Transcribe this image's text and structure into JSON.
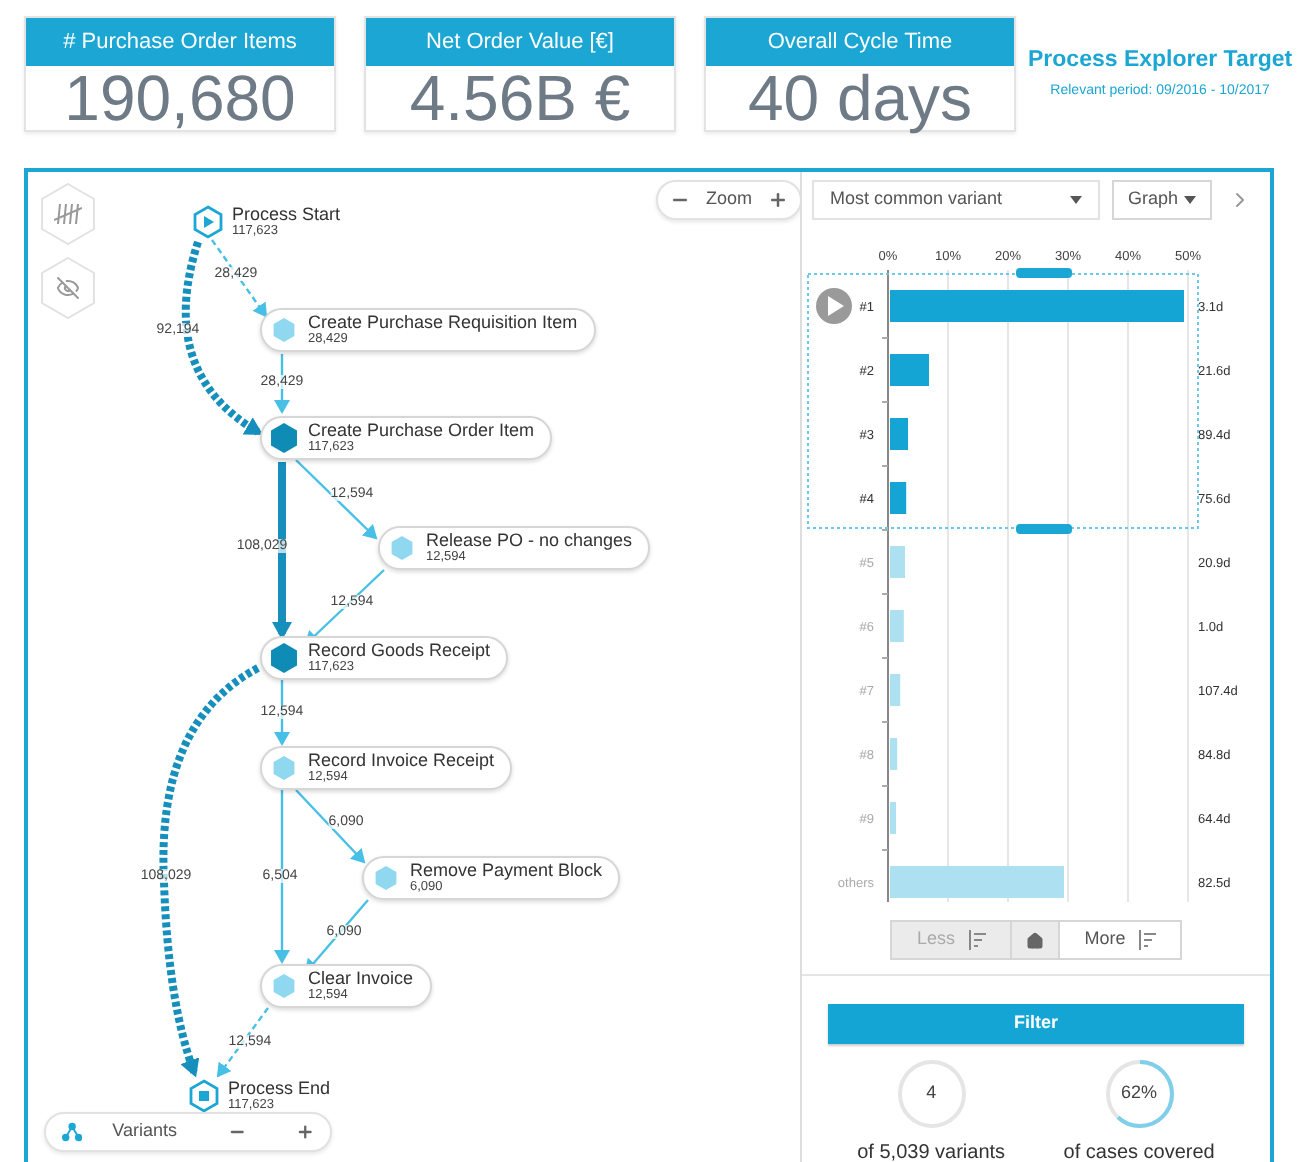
{
  "kpis": [
    {
      "title": "# Purchase Order Items",
      "value": "190,680"
    },
    {
      "title": "Net Order Value [€]",
      "value": "4.56B €"
    },
    {
      "title": "Overall Cycle Time",
      "value": "40 days"
    }
  ],
  "header": {
    "title": "Process Explorer Target",
    "period": "Relevant period: 09/2016 - 10/2017"
  },
  "process_graph": {
    "zoom_label": "Zoom",
    "variants_label": "Variants",
    "nodes": [
      {
        "kind": "start",
        "name": "Process Start",
        "count": "117,623"
      },
      {
        "kind": "minor",
        "name": "Create Purchase Requisition Item",
        "count": "28,429"
      },
      {
        "kind": "major",
        "name": "Create Purchase Order Item",
        "count": "117,623"
      },
      {
        "kind": "minor",
        "name": "Release PO - no changes",
        "count": "12,594"
      },
      {
        "kind": "major",
        "name": "Record Goods Receipt",
        "count": "117,623"
      },
      {
        "kind": "minor",
        "name": "Record Invoice Receipt",
        "count": "12,594"
      },
      {
        "kind": "minor",
        "name": "Remove Payment Block",
        "count": "6,090"
      },
      {
        "kind": "minor",
        "name": "Clear Invoice",
        "count": "12,594"
      },
      {
        "kind": "end",
        "name": "Process End",
        "count": "117,623"
      }
    ],
    "edges": [
      {
        "kind": "dashed",
        "label": "28,429"
      },
      {
        "kind": "dotted-thick",
        "label": "92,194"
      },
      {
        "kind": "solid",
        "label": "28,429"
      },
      {
        "kind": "solid",
        "label": "12,594"
      },
      {
        "kind": "solid-thick",
        "label": "108,029"
      },
      {
        "kind": "solid",
        "label": "12,594"
      },
      {
        "kind": "solid",
        "label": "12,594"
      },
      {
        "kind": "dotted-thick",
        "label": "108,029"
      },
      {
        "kind": "solid",
        "label": "6,090"
      },
      {
        "kind": "solid",
        "label": "6,504"
      },
      {
        "kind": "solid",
        "label": "6,090"
      },
      {
        "kind": "dashed",
        "label": "12,594"
      }
    ]
  },
  "variant_panel": {
    "dropdown": "Most common variant",
    "view_button": "Graph",
    "chart_data": {
      "type": "bar",
      "orientation": "horizontal",
      "grid": true,
      "categories": [
        "#1",
        "#2",
        "#3",
        "#4",
        "#5",
        "#6",
        "#7",
        "#8",
        "#9",
        "others"
      ],
      "values": [
        49,
        6.5,
        3,
        2.7,
        2.5,
        2.3,
        1.7,
        1.2,
        1.0,
        29
      ],
      "xlim": [
        0,
        50
      ],
      "xticks": [
        {
          "value": 0,
          "label": "0%"
        },
        {
          "value": 10,
          "label": "10%"
        },
        {
          "value": 20,
          "label": "20%"
        },
        {
          "value": 30,
          "label": "30%"
        },
        {
          "value": 40,
          "label": "40%"
        },
        {
          "value": 50,
          "label": "50%"
        }
      ]
    },
    "rows": [
      {
        "selected": true,
        "duration": "3.1d"
      },
      {
        "selected": true,
        "duration": "21.6d"
      },
      {
        "selected": true,
        "duration": "89.4d"
      },
      {
        "selected": true,
        "duration": "75.6d"
      },
      {
        "selected": false,
        "duration": "20.9d"
      },
      {
        "selected": false,
        "duration": "1.0d"
      },
      {
        "selected": false,
        "duration": "107.4d"
      },
      {
        "selected": false,
        "duration": "84.8d"
      },
      {
        "selected": false,
        "duration": "64.4d"
      },
      {
        "selected": false,
        "duration": "82.5d"
      }
    ],
    "less_button": {
      "label": "Less",
      "disabled": true
    },
    "more_button": {
      "label": "More",
      "disabled": false
    },
    "filter_button": "Filter",
    "stats": [
      {
        "value": "4",
        "caption": "of 5,039 variants"
      },
      {
        "value": "62%",
        "caption": "of cases covered",
        "level": 0.62
      }
    ]
  }
}
